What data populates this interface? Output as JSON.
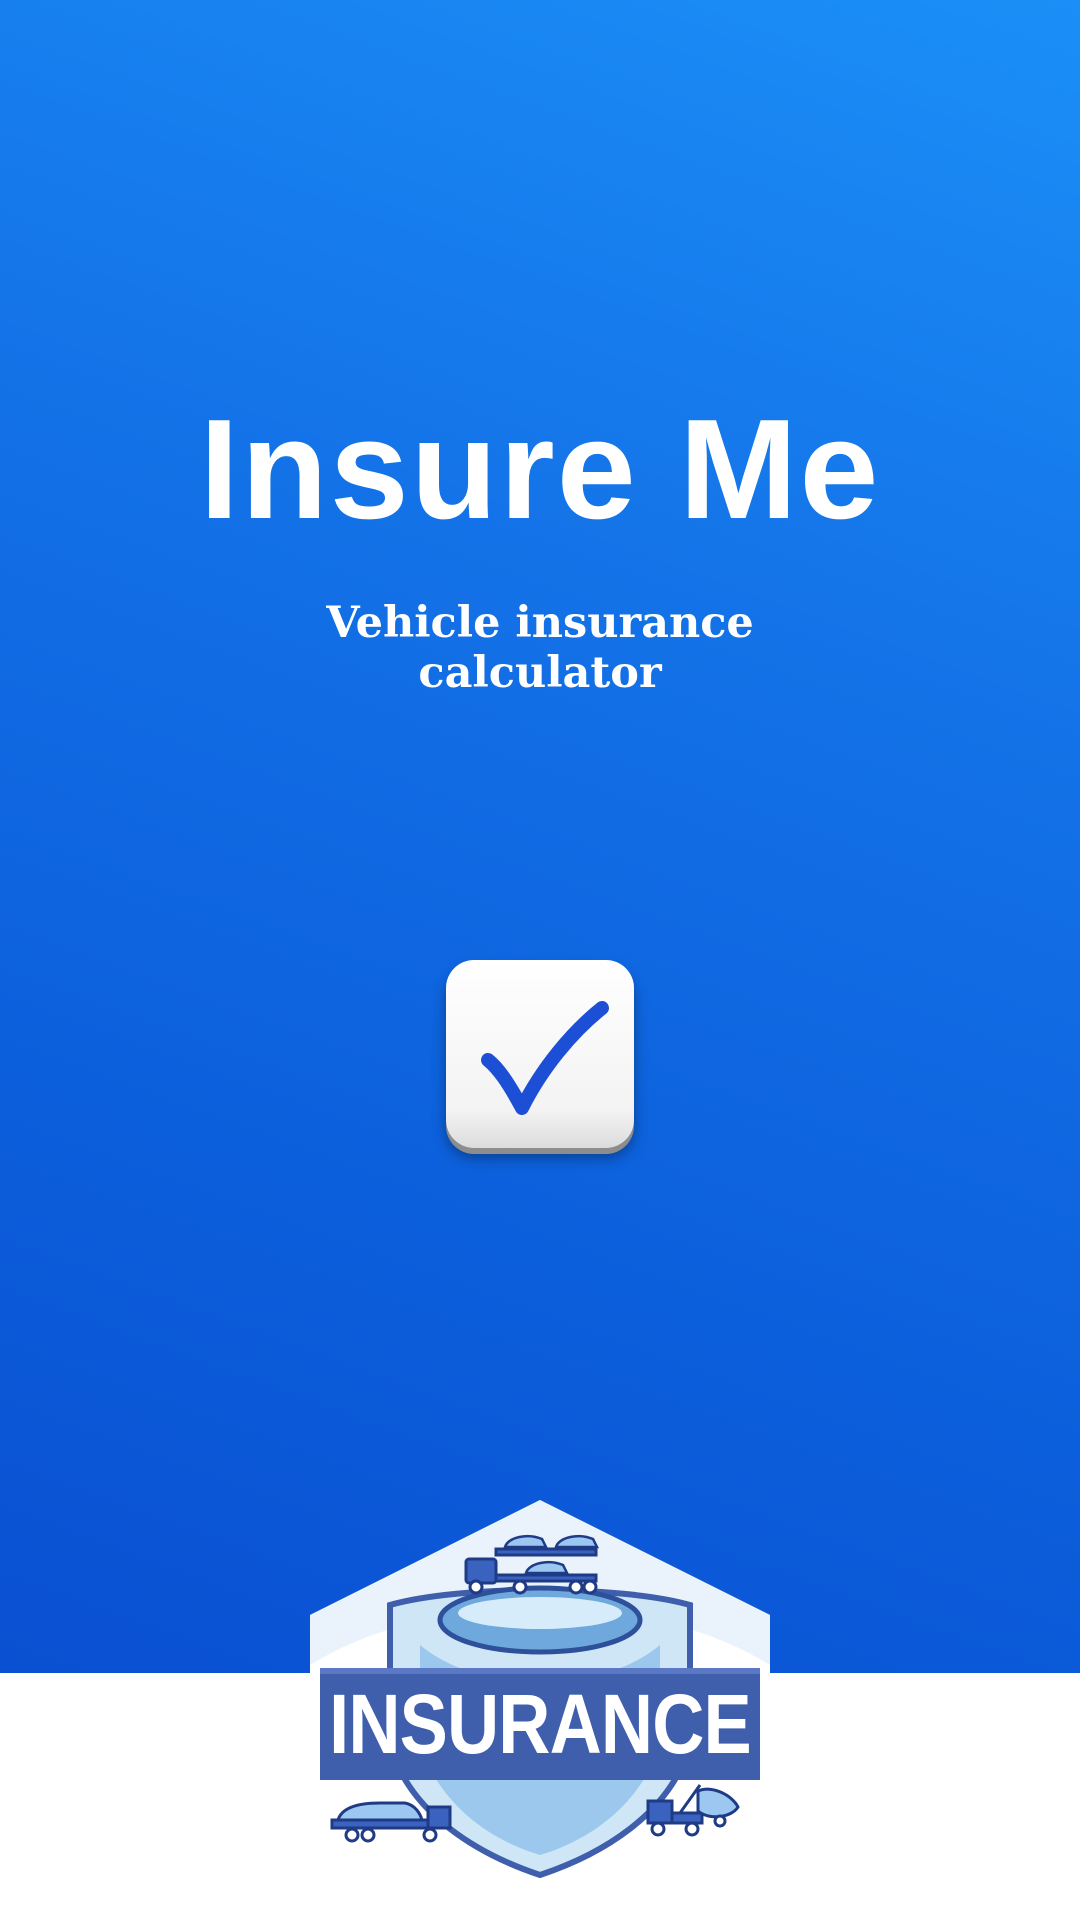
{
  "app": {
    "title": "Insure Me",
    "subtitle": "Vehicle insurance calculator"
  },
  "logo": {
    "icon": "checkmark-icon",
    "badge_text": "INSURANCE",
    "badge_icon": "insurance-shield-emblem"
  },
  "colors": {
    "gradient_top": "#1b8ff7",
    "gradient_bottom": "#0a50d2",
    "check_blue": "#1c4fd6",
    "badge_navy": "#3f5eac",
    "background_bottom": "#ffffff"
  }
}
